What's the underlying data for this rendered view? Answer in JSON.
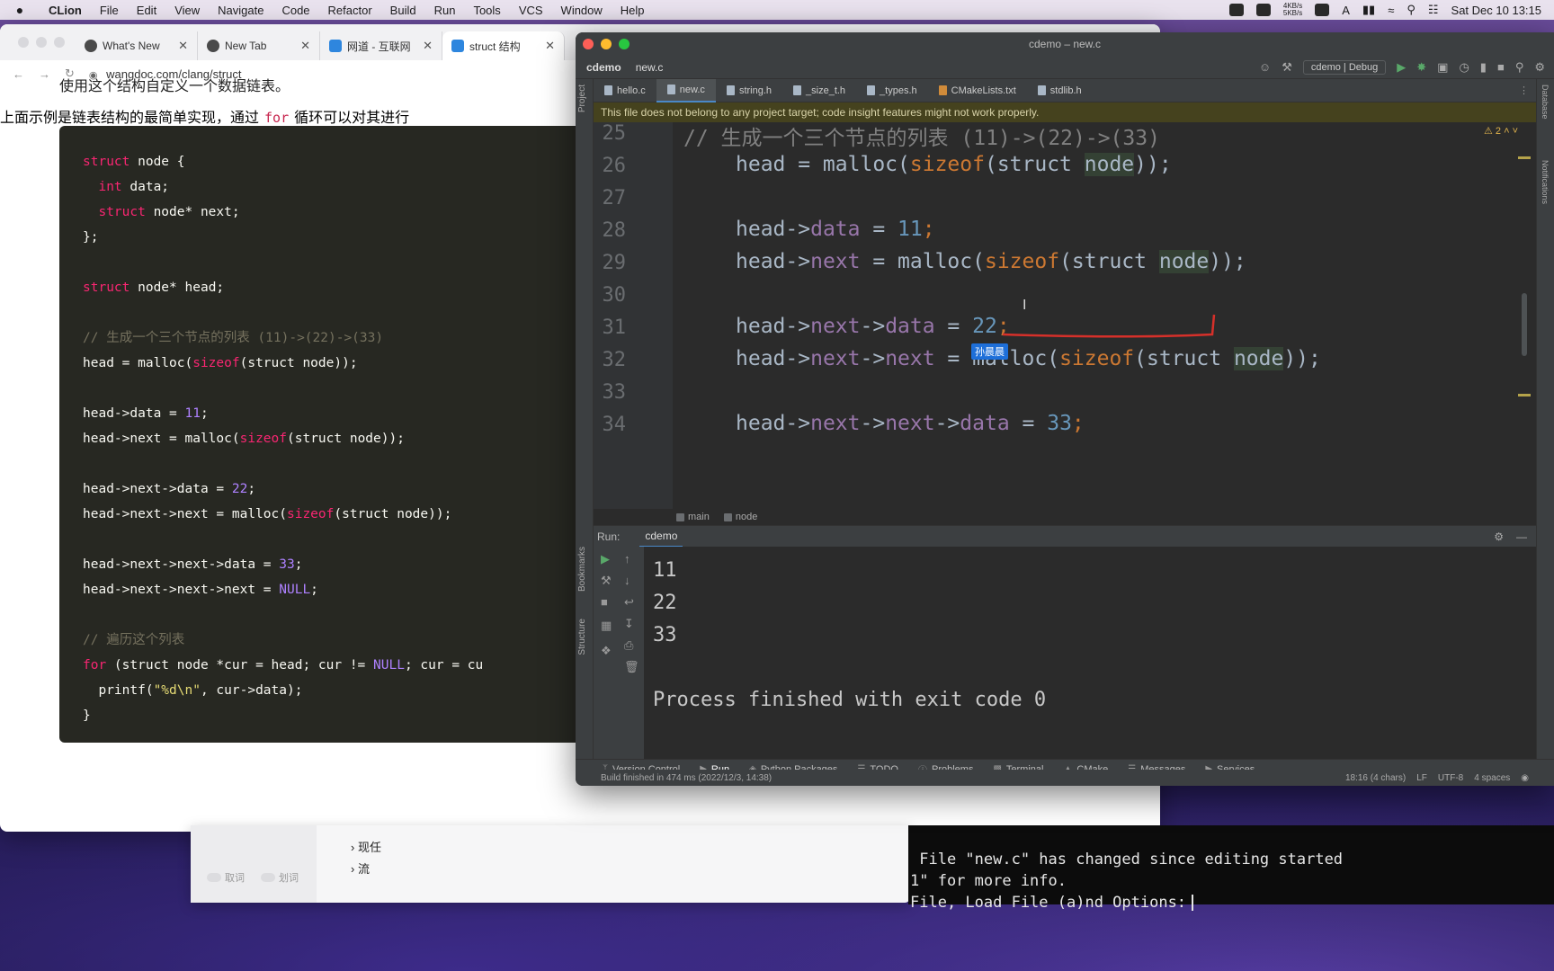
{
  "menubar": {
    "app_name": "CLion",
    "items": [
      "File",
      "Edit",
      "View",
      "Navigate",
      "Code",
      "Refactor",
      "Build",
      "Run",
      "Tools",
      "VCS",
      "Window",
      "Help"
    ],
    "net_up": "4KB/s",
    "net_down": "5KB/s",
    "input_method": "A",
    "datetime": "Sat Dec 10  13:15"
  },
  "browser": {
    "tabs": [
      {
        "title": "What's New",
        "active": false
      },
      {
        "title": "New Tab",
        "active": false
      },
      {
        "title": "网道 - 互联网",
        "active": false
      },
      {
        "title": "struct 结构",
        "active": true
      }
    ],
    "url": "wangdoc.com/clang/struct",
    "intro_text": "使用这个结构自定义一个数据链表。",
    "outro_before": "上面示例是链表结构的最简单实现，通过",
    "outro_code": "for",
    "outro_after": "循环可以对其进行"
  },
  "webcode": {
    "l1_kw": "struct",
    "l1_rest": " node {",
    "l2_kw": "  int",
    "l2_rest": " data;",
    "l3_kw": "  struct",
    "l3_rest": " node* next;",
    "l4": "};",
    "l6_kw": "struct",
    "l6_rest": " node* head;",
    "l8": "// 生成一个三个节点的列表 (11)->(22)->(33)",
    "l9_a": "head = malloc(",
    "l9_b": "sizeof",
    "l9_c": "(struct node));",
    "l11_a": "head->data = ",
    "l11_b": "11",
    "l11_c": ";",
    "l12_a": "head->next = malloc(",
    "l12_b": "sizeof",
    "l12_c": "(struct node));",
    "l14_a": "head->next->data = ",
    "l14_b": "22",
    "l14_c": ";",
    "l15_a": "head->next->next = malloc(",
    "l15_b": "sizeof",
    "l15_c": "(struct node));",
    "l17_a": "head->next->next->data = ",
    "l17_b": "33",
    "l17_c": ";",
    "l18_a": "head->next->next->next = ",
    "l18_b": "NULL",
    "l18_c": ";",
    "l20": "// 遍历这个列表",
    "l21_kw": "for",
    "l21_a": " (struct node *cur = head; cur != ",
    "l21_b": "NULL",
    "l21_c": "; cur = cu",
    "l22_a": "  printf(",
    "l22_b": "\"%d\\n\"",
    "l22_c": ", cur->data);",
    "l23": "}"
  },
  "dialog": {
    "item1": "现任",
    "item2": "流",
    "check1": "取词",
    "check2": "划词"
  },
  "terminal": {
    "line1": " File \"new.c\" has changed since editing started",
    "line2": "1\" for more info.",
    "line3": "File, Load File (a)nd Options:"
  },
  "ide": {
    "window_title": "cdemo – new.c",
    "nav_project": "cdemo",
    "nav_file": "new.c",
    "run_config": "cdemo | Debug",
    "editor_tabs": [
      "hello.c",
      "new.c",
      "string.h",
      "_size_t.h",
      "_types.h",
      "CMakeLists.txt",
      "stdlib.h"
    ],
    "active_tab": "new.c",
    "banner": "This file does not belong to any project target; code insight features might not work properly.",
    "warning_count": "2",
    "line_numbers": [
      "25",
      "26",
      "27",
      "28",
      "29",
      "30",
      "31",
      "32",
      "33",
      "34"
    ],
    "code": {
      "c25": "// 生成一个三个节点的列表 (11)->(22)->(33)",
      "c26_a": "head = malloc(",
      "c26_b": "sizeof",
      "c26_c": "(struct ",
      "c26_d": "node",
      "c26_e": "));",
      "c28_a": "head->",
      "c28_b": "data",
      "c28_c": " = ",
      "c28_d": "11",
      "c28_e": ";",
      "c29_a": "head->",
      "c29_b": "next",
      "c29_c": " = malloc(",
      "c29_d": "sizeof",
      "c29_e": "(struct ",
      "c29_f": "node",
      "c29_g": "));",
      "c31_a": "head->",
      "c31_b": "next",
      "c31_c": "->",
      "c31_d": "data",
      "c31_e": " = ",
      "c31_f": "22",
      "c31_g": ";",
      "c32_a": "head->",
      "c32_b": "next",
      "c32_c": "->",
      "c32_d": "next",
      "c32_e": " = malloc(",
      "c32_f": "sizeof",
      "c32_g": "(struct ",
      "c32_h": "node",
      "c32_i": "));",
      "c34_a": "head->",
      "c34_b": "next",
      "c34_c": "->",
      "c34_d": "next",
      "c34_e": "->",
      "c34_f": "data",
      "c34_g": " = ",
      "c34_h": "33",
      "c34_i": ";"
    },
    "annotation_badge": "孙晨晨",
    "structure_main": "main",
    "structure_node": "node",
    "run_label": "Run:",
    "run_tab": "cdemo",
    "output_lines": [
      "11",
      "22",
      "33"
    ],
    "output_finished": "Process finished with exit code 0",
    "tool_windows": [
      "Version Control",
      "Run",
      "Python Packages",
      "TODO",
      "Problems",
      "Terminal",
      "CMake",
      "Messages",
      "Services"
    ],
    "status_left": "Build finished in 474 ms (2022/12/3, 14:38)",
    "status_pos": "18:16 (4 chars)",
    "status_lf": "LF",
    "status_enc": "UTF-8",
    "status_indent": "4 spaces",
    "side_project": "Project",
    "side_bookmarks": "Bookmarks",
    "side_structure": "Structure",
    "side_database": "Database",
    "side_notifications": "Notifications"
  }
}
